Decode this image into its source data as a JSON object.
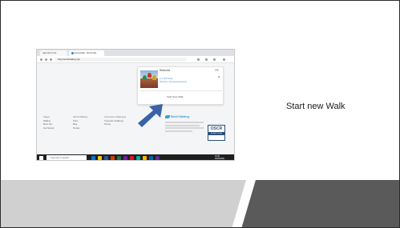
{
  "slide": {
    "caption": "Start new Walk"
  },
  "screenshot": {
    "browser": {
      "tabs": [
        "Agenda for Cle",
        "ExciteWalk - World Wal..."
      ],
      "url": "https://worldwalking.org/"
    },
    "popup": {
      "welcome": "Welcome",
      "link_1": "to 1,000 Steps",
      "link_2": "World for Volunteering Events",
      "cta": "Start New Walk"
    },
    "footer": {
      "col_1": {
        "head": "Pages",
        "items": [
          "Walking",
          "Book Tips",
          "Get Started"
        ]
      },
      "col_2": {
        "head": "World Walking",
        "items": [
          "Team",
          "Blog",
          "Donate"
        ]
      },
      "col_3": {
        "head": "Corporate Challenges",
        "items": [
          "Corporate Challenge",
          "Pricing"
        ]
      },
      "brand": "World Walking",
      "badge_top": "OSCR",
      "badge_bottom": "Scottish Charity"
    },
    "taskbar": {
      "search": "Type here to search",
      "clock_time": "16:30",
      "clock_date": "20/06/2020"
    }
  },
  "colors": {
    "footer_light": "#d0d0d0",
    "footer_dark": "#5a5a5a",
    "arrow": "#3b62a8"
  }
}
